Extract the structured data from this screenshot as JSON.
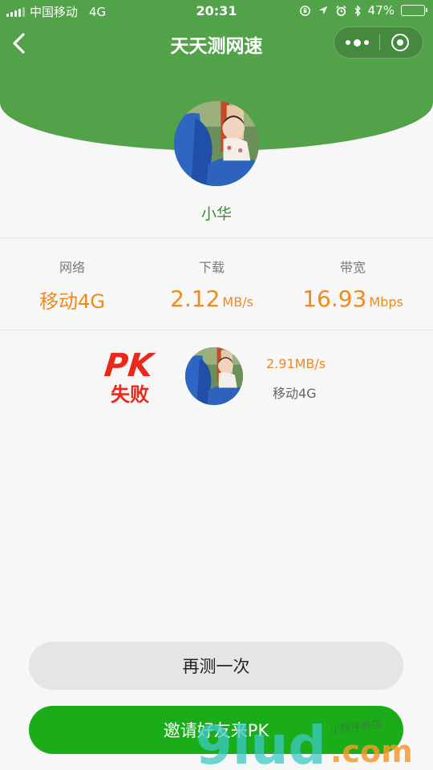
{
  "status_bar": {
    "carrier": "中国移动",
    "network": "4G",
    "time": "20:31",
    "battery_text": "47%",
    "battery_level": 0.47
  },
  "nav": {
    "title": "天天测网速"
  },
  "user": {
    "name": "小华"
  },
  "stats": {
    "network": {
      "label": "网络",
      "value": "移动4G"
    },
    "download": {
      "label": "下载",
      "value": "2.12",
      "unit": "MB/s"
    },
    "bandwidth": {
      "label": "带宽",
      "value": "16.93",
      "unit": "Mbps"
    }
  },
  "pk": {
    "badge_top": "PK",
    "badge_bottom": "失败",
    "opponent_speed": "2.91MB/s",
    "opponent_network": "移动4G"
  },
  "buttons": {
    "retest": "再测一次",
    "invite": "邀请好友来PK"
  },
  "watermark": {
    "brand": "9lud",
    "suffix": ".com",
    "tagline": "小程序商店"
  },
  "colors": {
    "header_green": "#52a24a",
    "accent_orange": "#ef8a1c",
    "primary_green": "#1aad19",
    "pk_red": "#e8291c"
  }
}
